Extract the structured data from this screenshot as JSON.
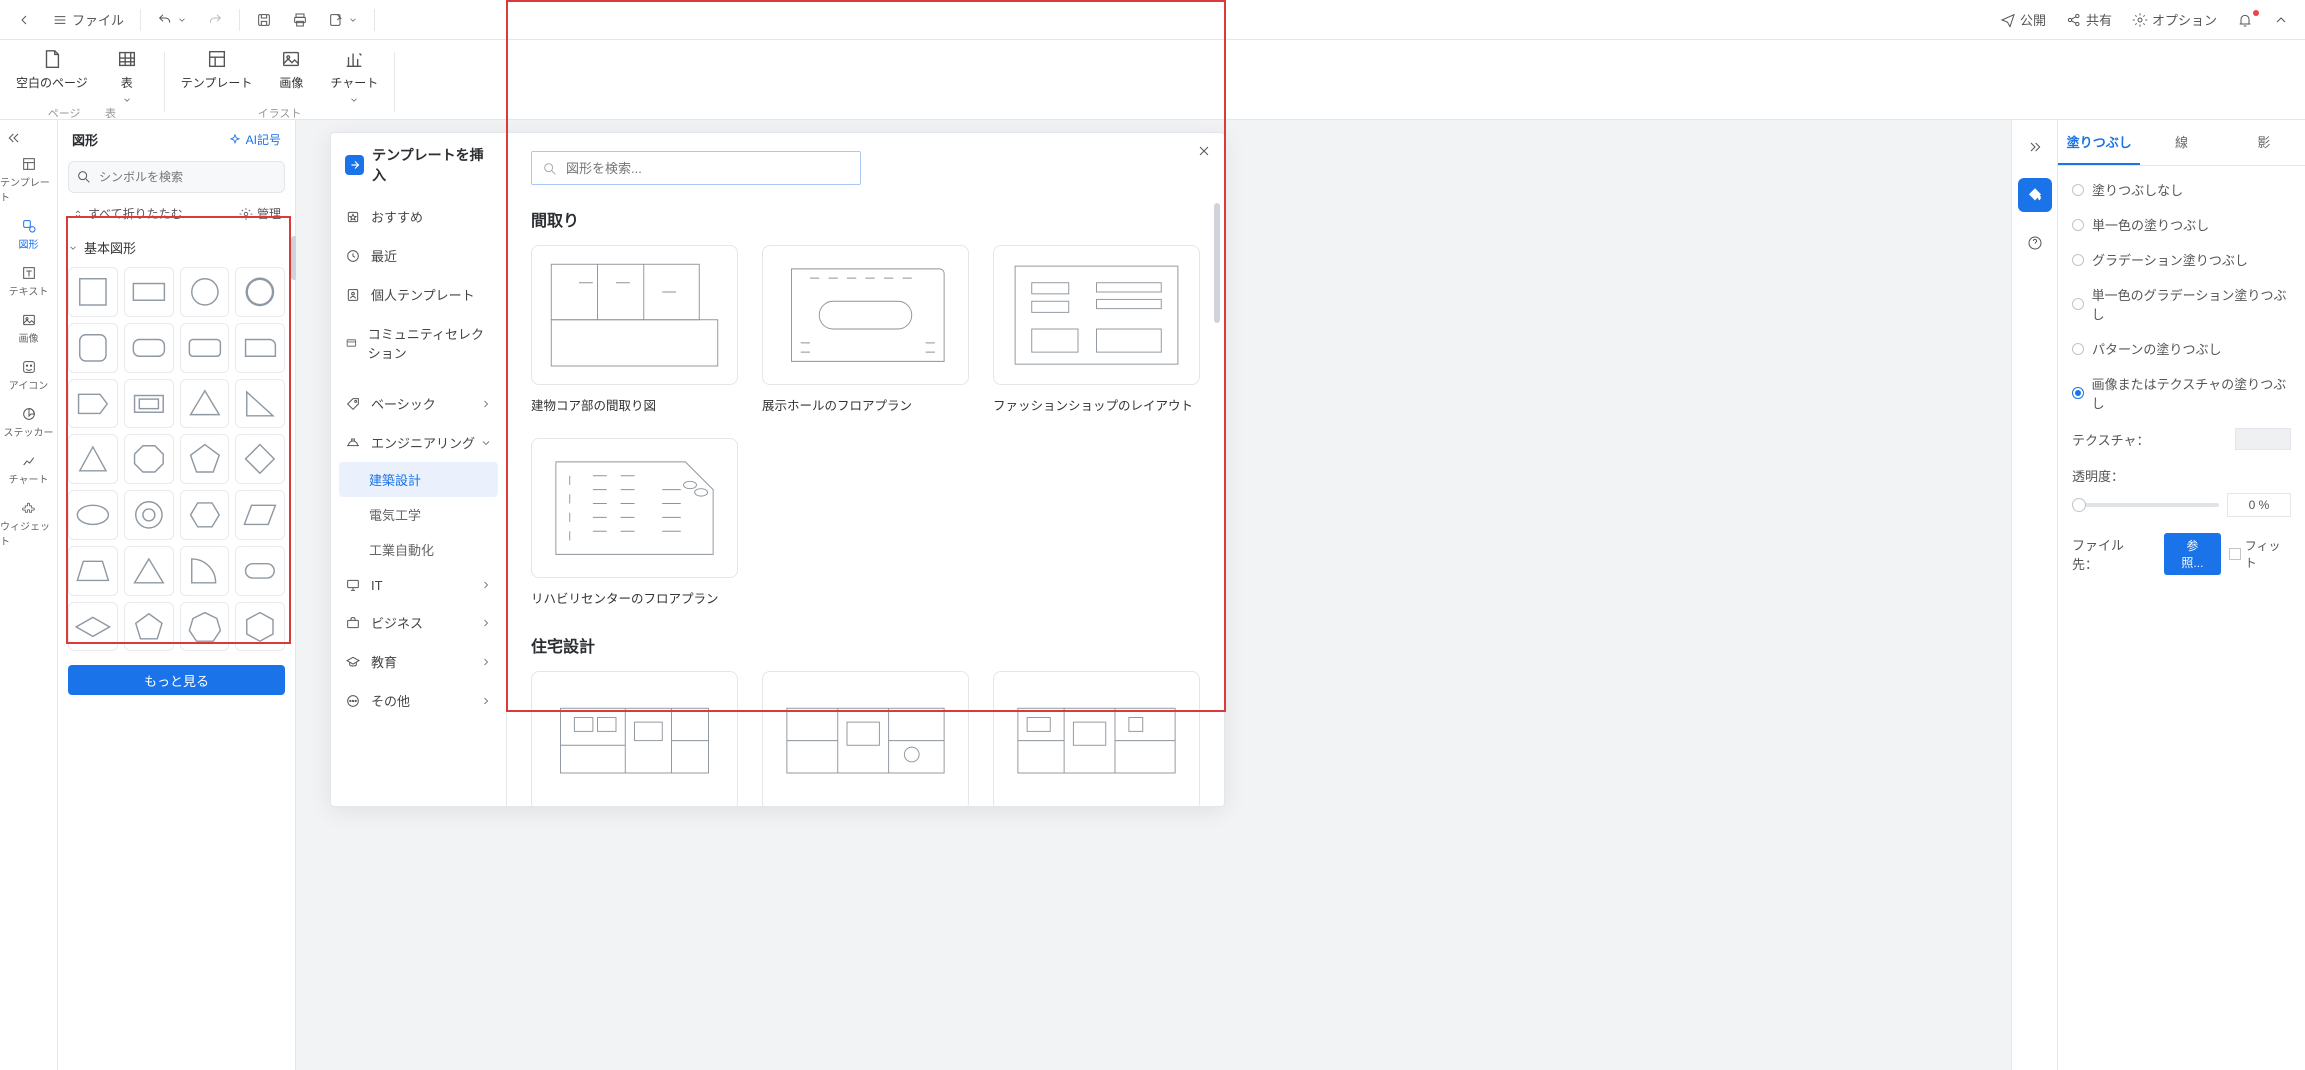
{
  "toolbar": {
    "file_label": "ファイル",
    "publish": "公開",
    "share": "共有",
    "options": "オプション"
  },
  "ribbon": {
    "page_blank": "空白のページ",
    "table": "表",
    "template": "テンプレート",
    "image": "画像",
    "chart": "チャート",
    "grp_page": "ページ",
    "grp_table": "表",
    "grp_illust": "イラスト"
  },
  "rail": {
    "template": "テンプレート",
    "shape": "図形",
    "text": "テキスト",
    "image": "画像",
    "icon": "アイコン",
    "sticker": "ステッカー",
    "chart": "チャート",
    "widget": "ウィジェット"
  },
  "shapes": {
    "title": "図形",
    "ai": "AI記号",
    "search_ph": "シンボルを検索",
    "fold_all": "すべて折りたたむ",
    "manage": "管理",
    "section_basic": "基本図形",
    "more": "もっと見る"
  },
  "right": {
    "tab_fill": "塗りつぶし",
    "tab_line": "線",
    "tab_shadow": "影",
    "r0": "塗りつぶしなし",
    "r1": "単一色の塗りつぶし",
    "r2": "グラデーション塗りつぶし",
    "r3": "単一色のグラデーション塗りつぶし",
    "r4": "パターンの塗りつぶし",
    "r5": "画像またはテクスチャの塗りつぶし",
    "texture_lbl": "テクスチャ：",
    "opacity_lbl": "透明度：",
    "opacity_pct": "0 %",
    "file_lbl": "ファイル先：",
    "browse": "参照...",
    "fit": "フィット"
  },
  "modal": {
    "title": "テンプレートを挿入",
    "search_ph": "図形を検索...",
    "cats": {
      "recommend": "おすすめ",
      "recent": "最近",
      "personal": "個人テンプレート",
      "community": "コミュニティセレクション",
      "basic": "ベーシック",
      "engineering": "エンジニアリング",
      "sub_arch": "建築設計",
      "sub_elec": "電気工学",
      "sub_ind": "工業自動化",
      "it": "IT",
      "business": "ビジネス",
      "edu": "教育",
      "other": "その他"
    },
    "h1": "間取り",
    "cards1": [
      "建物コア部の間取り図",
      "展示ホールのフロアプラン",
      "ファッションショップのレイアウト",
      "リハビリセンターのフロアプラン"
    ],
    "h2": "住宅設計"
  }
}
